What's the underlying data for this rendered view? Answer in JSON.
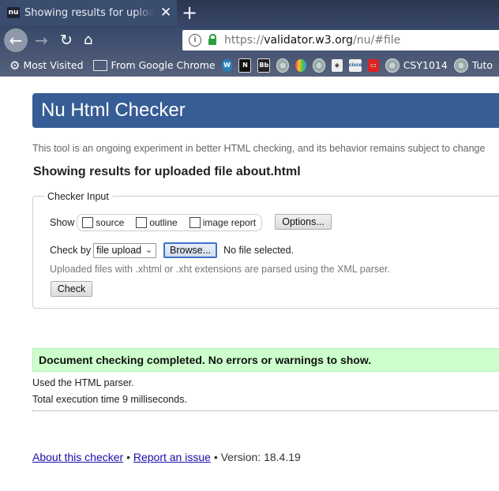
{
  "browser": {
    "tab": {
      "favicon": "nu",
      "title": "Showing results for uploaded file about.html"
    },
    "url": {
      "scheme": "https://",
      "domain": "validator.w3.org",
      "path": "/nu/#file"
    },
    "bookmarks": [
      {
        "label": "Most Visited",
        "icon": "gear-icon"
      },
      {
        "label": "From Google Chrome",
        "icon": "folder-icon"
      },
      {
        "label": "",
        "icon": "wordpress-icon"
      },
      {
        "label": "",
        "icon": "n-icon"
      },
      {
        "label": "",
        "icon": "bb-icon"
      },
      {
        "label": "",
        "icon": "globe-icon"
      },
      {
        "label": "",
        "icon": "rainbow-icon"
      },
      {
        "label": "",
        "icon": "globe-icon"
      },
      {
        "label": "",
        "icon": "diamond-icon"
      },
      {
        "label": "",
        "icon": "cisco-icon"
      },
      {
        "label": "",
        "icon": "red-icon"
      },
      {
        "label": "CSY1014",
        "icon": "globe-icon"
      },
      {
        "label": "Tuto",
        "icon": "globe-icon"
      }
    ]
  },
  "page": {
    "title": "Nu Html Checker",
    "intro": "This tool is an ongoing experiment in better HTML checking, and its behavior remains subject to change",
    "results_heading": "Showing results for uploaded file about.html",
    "checker_input": {
      "legend": "Checker Input",
      "show_label": "Show",
      "options": [
        "source",
        "outline",
        "image report"
      ],
      "options_button": "Options...",
      "check_by_label": "Check by",
      "check_by_value": "file upload",
      "browse_button": "Browse...",
      "no_file": "No file selected.",
      "xml_note": "Uploaded files with .xhtml or .xht extensions are parsed using the XML parser.",
      "check_button": "Check"
    },
    "success_message": "Document checking completed. No errors or warnings to show.",
    "parser_used": "Used the HTML parser.",
    "execution_time": "Total execution time 9 milliseconds.",
    "footer": {
      "about": "About this checker",
      "sep1": "•",
      "report": "Report an issue",
      "sep2": "•",
      "version": "Version: 18.4.19"
    }
  }
}
